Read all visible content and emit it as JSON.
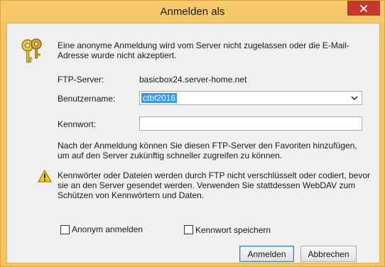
{
  "window": {
    "title": "Anmelden als",
    "close_icon": "close-icon"
  },
  "dialog": {
    "key_icon": "keys-icon",
    "message": "Eine anonyme Anmeldung wird vom Server nicht zugelassen oder die E-Mail-Adresse wurde nicht akzeptiert.",
    "ftp_server_label": "FTP-Server:",
    "ftp_server_value": "basicbox24.server-home.net",
    "username_label": "Benutzername:",
    "username_value": "ctbf2016",
    "password_label": "Kennwort:",
    "password_value": "",
    "info_text": "Nach der Anmeldung können Sie diesen FTP-Server den Favoriten hinzufügen, um auf den Server zukünftig schneller zugreifen zu können.",
    "warning_icon": "warning-icon",
    "warning_text": "Kennwörter oder Dateien werden durch FTP nicht verschlüsselt oder codiert, bevor sie an den Server gesendet werden. Verwenden Sie stattdessen WebDAV zum Schützen von Kennwörtern und Daten.",
    "anonymous_label": "Anonym anmelden",
    "anonymous_checked": false,
    "save_password_label": "Kennwort speichern",
    "save_password_checked": false,
    "login_button": "Anmelden",
    "cancel_button": "Abbrechen"
  },
  "colors": {
    "frame": "#f2c562",
    "close": "#c8372d",
    "selection": "#3399ff",
    "client": "#f0f0f0"
  }
}
